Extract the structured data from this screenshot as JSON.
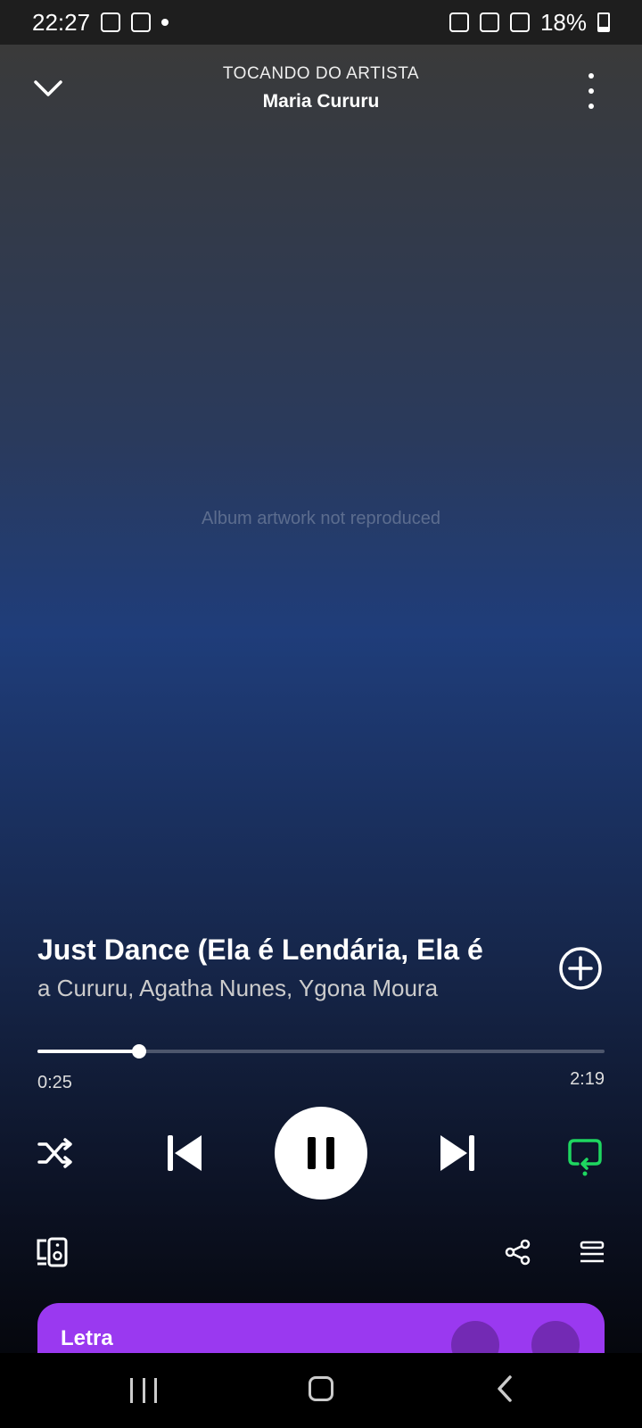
{
  "status_bar": {
    "time": "22:27",
    "battery": "18%"
  },
  "artwork_note": "Album artwork not reproduced",
  "header": {
    "context_label": "TOCANDO DO ARTISTA",
    "context_title": "Maria Cururu"
  },
  "track": {
    "title": "Just Dance (Ela é Lendária, Ela é",
    "artists": "a Cururu, Agatha Nunes, Ygona Moura"
  },
  "playback": {
    "elapsed": "0:25",
    "duration": "2:19",
    "progress": 0.18,
    "is_playing": true,
    "repeat_active": true
  },
  "lyrics": {
    "label": "Letra"
  },
  "icons": [
    "chevron-down-icon",
    "more-vert-icon",
    "add-circle-icon",
    "shuffle-icon",
    "skip-previous-icon",
    "pause-icon",
    "skip-next-icon",
    "repeat-icon",
    "devices-icon",
    "share-icon",
    "queue-icon",
    "expand-icon"
  ],
  "colors": {
    "accent": "#1ed760",
    "lyrics_card": "#9a39f0"
  }
}
